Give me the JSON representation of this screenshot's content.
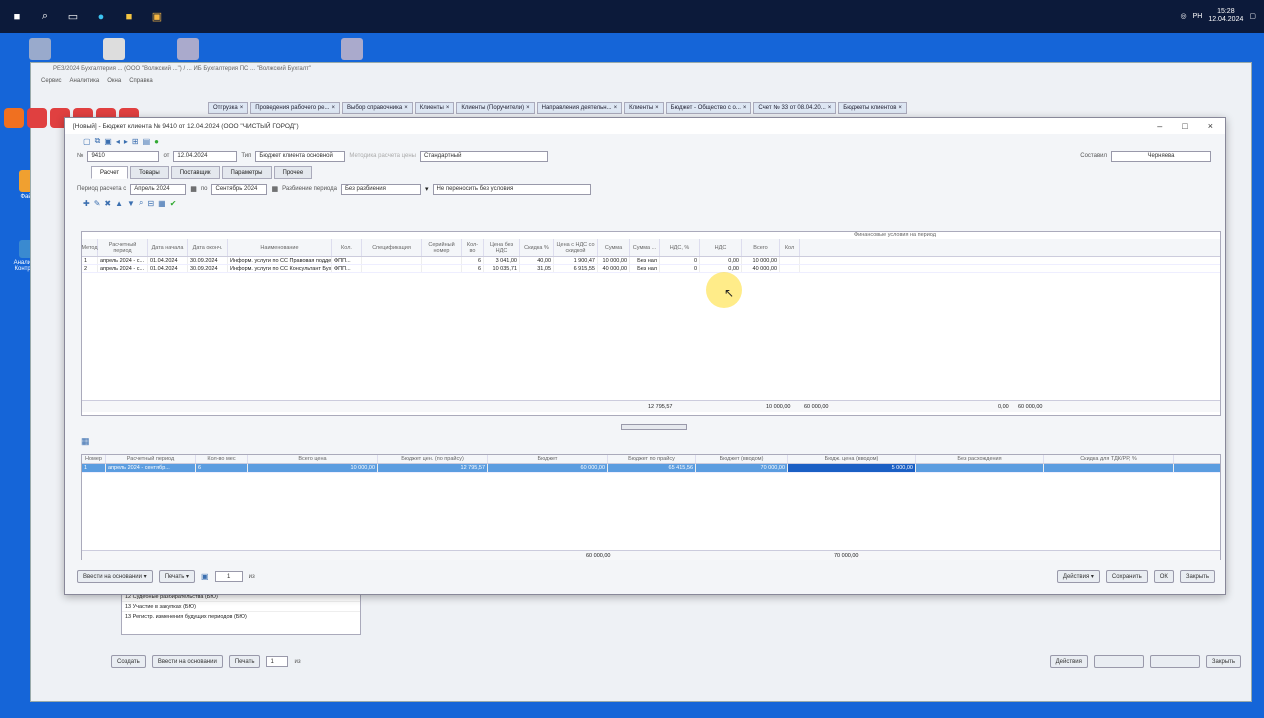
{
  "taskbar": {
    "clock_time": "15:28",
    "clock_date": "12.04.2024",
    "lang": "PH"
  },
  "desktop_icons": [
    "Файлы",
    "Анализатор Контрагент"
  ],
  "bg_window": {
    "title": "РЕЗ/2024 Бухгалтерия ... (ООО \"Волжский ...\") / ... ИБ Бухгалтерия ПС ... \"Волжский Бухгалт\"",
    "menu": [
      "Сервис",
      "Аналитика",
      "Окна",
      "Справка"
    ],
    "tabs": [
      "Отгрузка",
      "Проведения рабочего ре...",
      "Выбор справочника",
      "Клиенты",
      "Клиенты (Поручители)",
      "Направления деятельн...",
      "Клиенты",
      "Бюджет - Общество с о...",
      "Счет № 33 от 08.04.20...",
      "Бюджеты клиентов"
    ],
    "list_rows": [
      "12 Судебные разбирательства (БЮ)",
      "13 Участие в закупках (БЮ)",
      "13 Регистр. изменения будущих периодов (БЮ)"
    ],
    "bottom": {
      "create": "Создать",
      "enter": "Ввести на основании",
      "print": "Печать",
      "page": "1",
      "of": "из",
      "actions": "Действия",
      "close": "Закрыть"
    }
  },
  "win": {
    "title": "[Новый] - Бюджет клиента № 9410 от 12.04.2024 (ООО \"ЧИСТЫЙ ГОРОД\")",
    "number_label": "№",
    "number": "9410",
    "date_label": "от",
    "date": "12.04.2024",
    "type_label": "Тип",
    "type_value": "Бюджет клиента основной",
    "estimate_label": "Методика расчета цены",
    "estimate_value": "Стандартный",
    "author_label": "Составил",
    "author_value": "Черняева",
    "tabs": [
      "Расчет",
      "Товары",
      "Поставщик",
      "Параметры",
      "Прочее"
    ],
    "period_label": "Период расчета с",
    "period_from": "Апрель 2024",
    "period_to_label": "по",
    "period_to": "Сентябрь 2024",
    "split_label": "Разбиение периода",
    "split_value": "Без разбиения",
    "no_split_label": "Не переносить без условия",
    "grid1": {
      "group_header": "Финансовые условия на период",
      "headers": [
        "Метод",
        "Расчетный период",
        "Дата начала",
        "Дата оконч.",
        "Наименование",
        "Кол.",
        "Спецификация",
        "Серийный номер",
        "Кол-во",
        "Цена без НДС",
        "Скидка %",
        "Цена с НДС со скидкой",
        "Сумма",
        "Сумма ...",
        "НДС, %",
        "НДС",
        "Всего",
        "Кол"
      ],
      "rows": [
        [
          "1",
          "апрель 2024 - с...",
          "01.04.2024",
          "30.09.2024",
          "Информ. услуги по СС Правовая поддержка...",
          "ФПП...",
          "",
          "",
          "6",
          "3 041,00",
          "40,00",
          "1 900,47",
          "10 000,00",
          "Без нал",
          "0",
          "0,00",
          "10 000,00",
          ""
        ],
        [
          "2",
          "апрель 2024 - с...",
          "01.04.2024",
          "30.09.2024",
          "Информ. услуги по СС Консультант Бухгал...",
          "ФПП...",
          "",
          "",
          "6",
          "10 035,71",
          "31,05",
          "6 915,55",
          "40 000,00",
          "Без нал",
          "0",
          "0,00",
          "40 000,00",
          ""
        ]
      ],
      "totals": {
        "price": "12 795,57",
        "sum1": "10 000,00",
        "sum2": "60 000,00",
        "nds": "0,00",
        "total": "60 000,00"
      }
    },
    "grid2": {
      "headers": [
        "Номер",
        "Расчетный период",
        "Кол-во мес",
        "Всего цена",
        "Бюджет цен. (по прайсу)",
        "Бюджет",
        "Бюджет по прайсу",
        "Бюджет (вводом)",
        "Бюдж. цена (вводом)",
        "Без расхождения",
        "Скидка для ТДК/РР, %"
      ],
      "row": [
        "1",
        "апрель 2024 - сентябр...",
        "6",
        "10 000,00",
        "12 795,57",
        "60 000,00",
        "65 415,56",
        "70 000,00",
        "5 000,00",
        "",
        ""
      ],
      "totals": {
        "budget": "60 000,00",
        "entry": "70 000,00"
      }
    },
    "bottom": {
      "enter": "Ввести на основании",
      "print": "Печать",
      "page": "1",
      "of": "из",
      "actions": "Действия",
      "save": "Сохранить",
      "ok": "ОК",
      "close": "Закрыть"
    }
  }
}
